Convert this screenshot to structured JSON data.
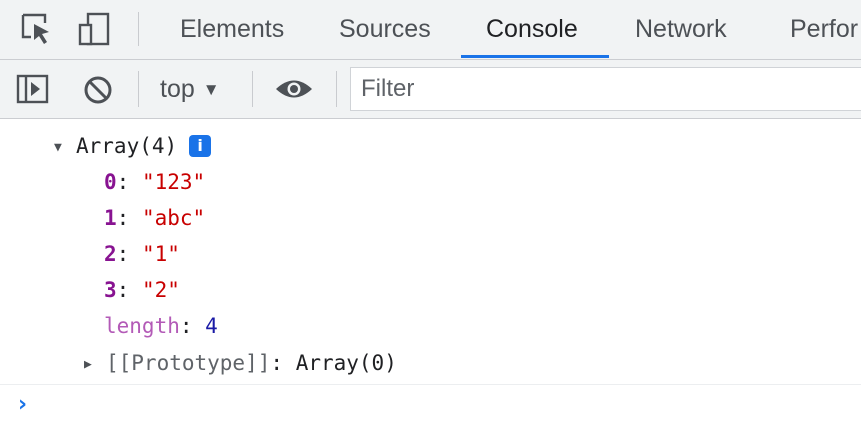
{
  "tabs": [
    {
      "label": "Elements"
    },
    {
      "label": "Sources"
    },
    {
      "label": "Console",
      "active": true
    },
    {
      "label": "Network"
    },
    {
      "label": "Perfor"
    }
  ],
  "toolbar": {
    "context": "top",
    "filter_placeholder": "Filter"
  },
  "console": {
    "array_header": "Array(4)",
    "info_badge": "i",
    "items": [
      {
        "key": "0",
        "value": "\"123\""
      },
      {
        "key": "1",
        "value": "\"abc\""
      },
      {
        "key": "2",
        "value": "\"1\""
      },
      {
        "key": "3",
        "value": "\"2\""
      }
    ],
    "length_key": "length",
    "length_value": "4",
    "prototype_key": "[[Prototype]]",
    "prototype_value": "Array(0)",
    "colon": ":"
  },
  "colors": {
    "accent": "#1a73e8",
    "string": "#c80000",
    "key": "#881391",
    "number": "#1a1aa6"
  }
}
